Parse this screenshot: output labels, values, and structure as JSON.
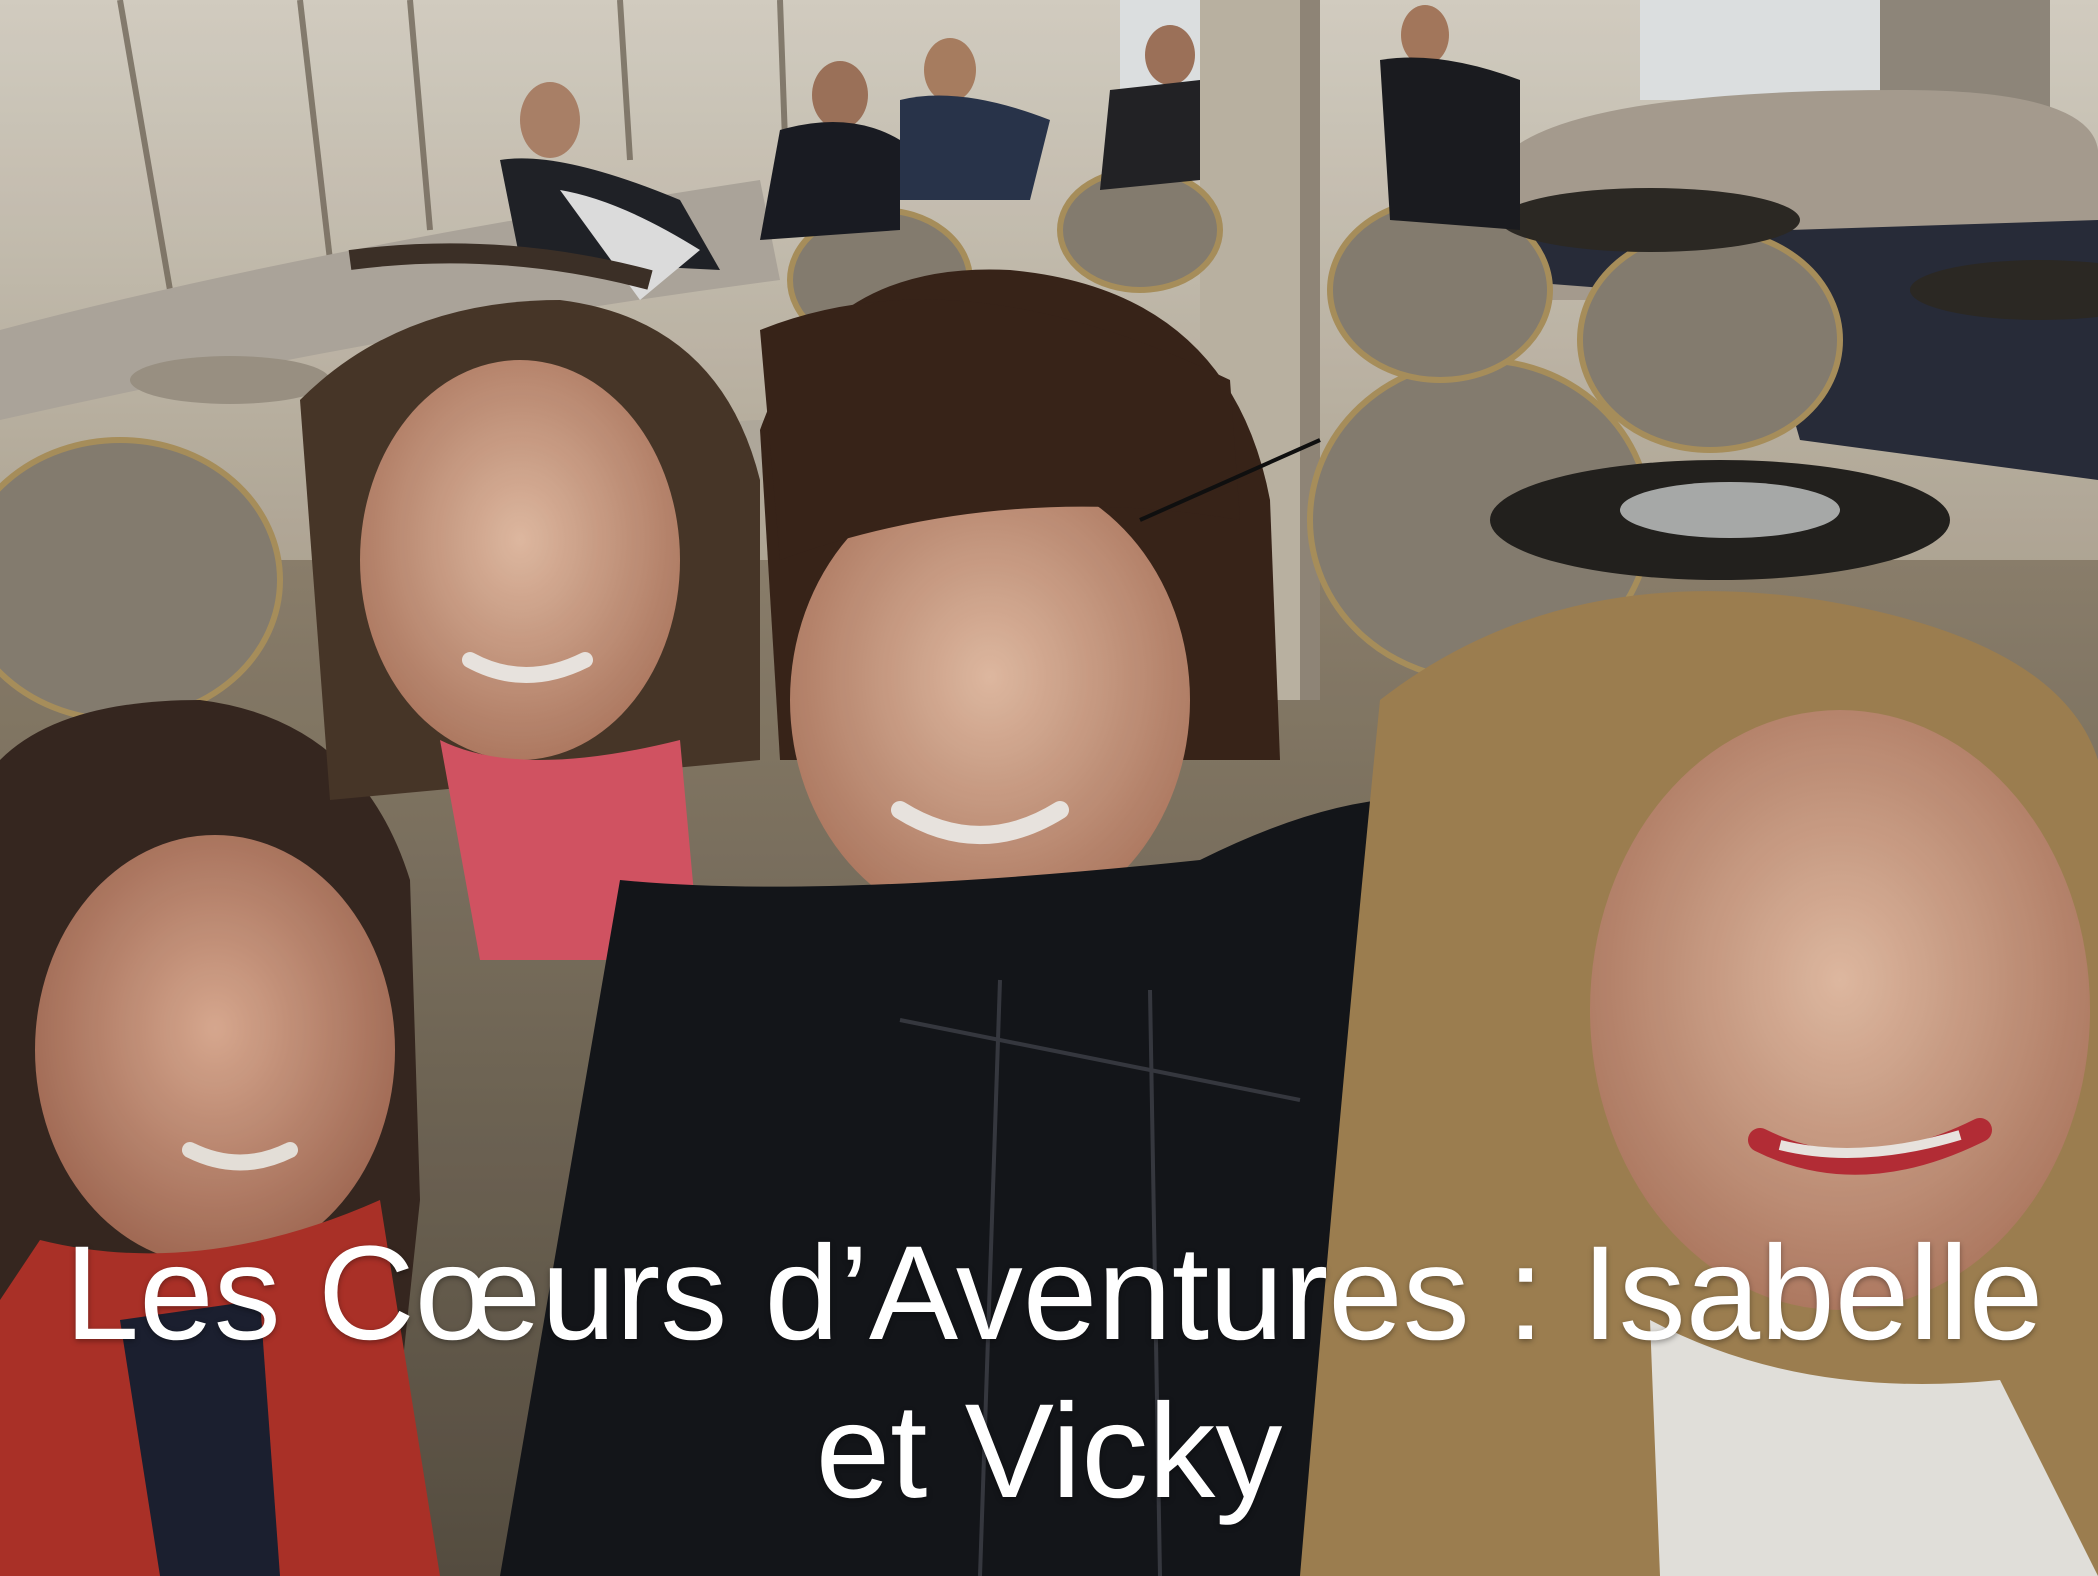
{
  "photo": {
    "alt": "Selfie of four women smiling in a ship lounge with people seated on sofas behind them",
    "caption": {
      "line1": "Les Cœurs d’Aventures : Isabelle",
      "line2": "et Vicky"
    }
  },
  "colors": {
    "caption_text": "#ffffff",
    "wall": "#cfc6b6",
    "sofa": "#b9b1a6",
    "floor": "#8a7e6c"
  }
}
